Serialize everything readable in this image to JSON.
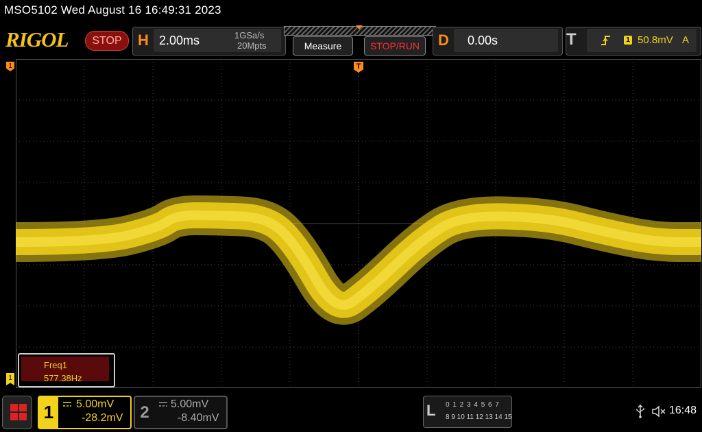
{
  "window": {
    "title": "MSO5102  Wed August 16 16:49:31 2023"
  },
  "header": {
    "logo": "RIGOL",
    "run_state": "STOP",
    "horizontal": {
      "letter": "H",
      "timebase": "2.00ms",
      "sample_rate": "1GSa/s",
      "memory_depth": "20Mpts"
    },
    "measure_button": "Measure",
    "stoprun_button": "STOP/RUN",
    "delay": {
      "letter": "D",
      "value": "0.00s"
    },
    "trigger": {
      "letter": "T",
      "source": "1",
      "level": "50.8mV",
      "mode": "A"
    }
  },
  "markers": {
    "ch1_ref": "1",
    "trigger_position": "T",
    "ch1_level": "1"
  },
  "measurement": {
    "name": "Freq1",
    "value": "577.38Hz"
  },
  "channels": [
    {
      "number": "1",
      "scale": "5.00mV",
      "offset": "-28.2mV",
      "color": "#f2d21b",
      "active": true
    },
    {
      "number": "2",
      "scale": "5.00mV",
      "offset": "-8.40mV",
      "color": "#999999",
      "active": false
    }
  ],
  "logic_analyzer": {
    "letter": "L",
    "row1": "0 1 2 3  4 5 6 7",
    "row2": "8 9 10 11 12 13 14 15"
  },
  "status": {
    "time": "16:48"
  },
  "colors": {
    "trace": "#f2d21b",
    "grid": "#4a4a4a",
    "accent": "#ff8a1a",
    "alert": "#ff3030"
  },
  "waveform": {
    "description_levels_div": "trace position in grid divisions (0 = center)",
    "points": [
      [
        0,
        -0.45
      ],
      [
        1.5,
        -0.45
      ],
      [
        2.5,
        -0.1
      ],
      [
        2.8,
        0.2
      ],
      [
        3.5,
        0.2
      ],
      [
        4.4,
        0.15
      ],
      [
        4.9,
        -0.5
      ],
      [
        5.6,
        -2.2
      ],
      [
        6.2,
        -1.6
      ],
      [
        7.1,
        -0.4
      ],
      [
        7.8,
        0.2
      ],
      [
        9.3,
        0.15
      ],
      [
        10.3,
        -0.2
      ],
      [
        11.2,
        -0.45
      ],
      [
        12.0,
        -0.45
      ]
    ]
  }
}
